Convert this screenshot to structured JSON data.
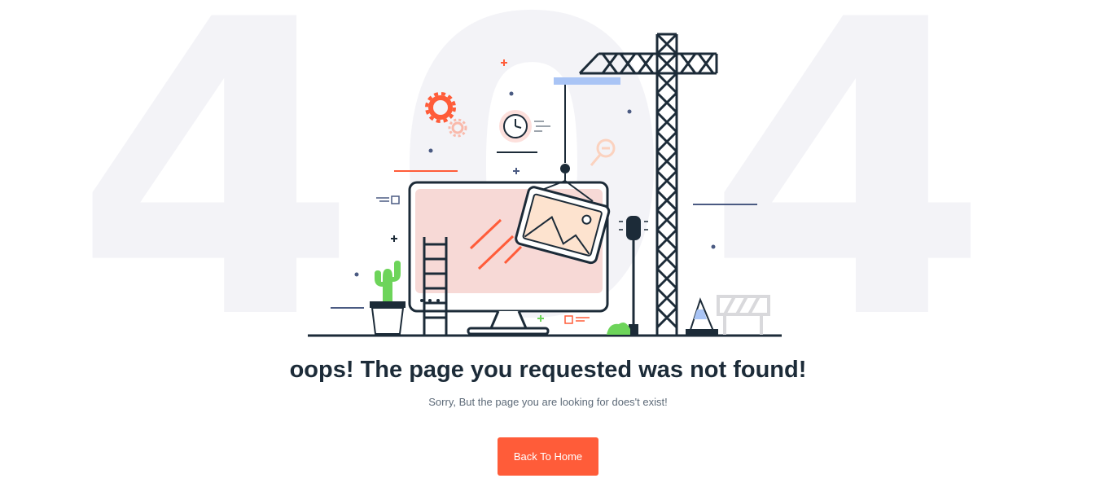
{
  "background_code": "404",
  "heading": "oops! The page you requested was not found!",
  "message": "Sorry, But the page you are looking for does't exist!",
  "button": {
    "label": "Back To Home"
  },
  "colors": {
    "accent": "#ff5c39",
    "dark": "#1c2b38",
    "muted_text": "#5d6a78",
    "watermark": "#f3f3f7",
    "screen_pink": "#f7d9d6",
    "cactus_green": "#6dd45a",
    "crane_blue": "#a9c4f5"
  }
}
